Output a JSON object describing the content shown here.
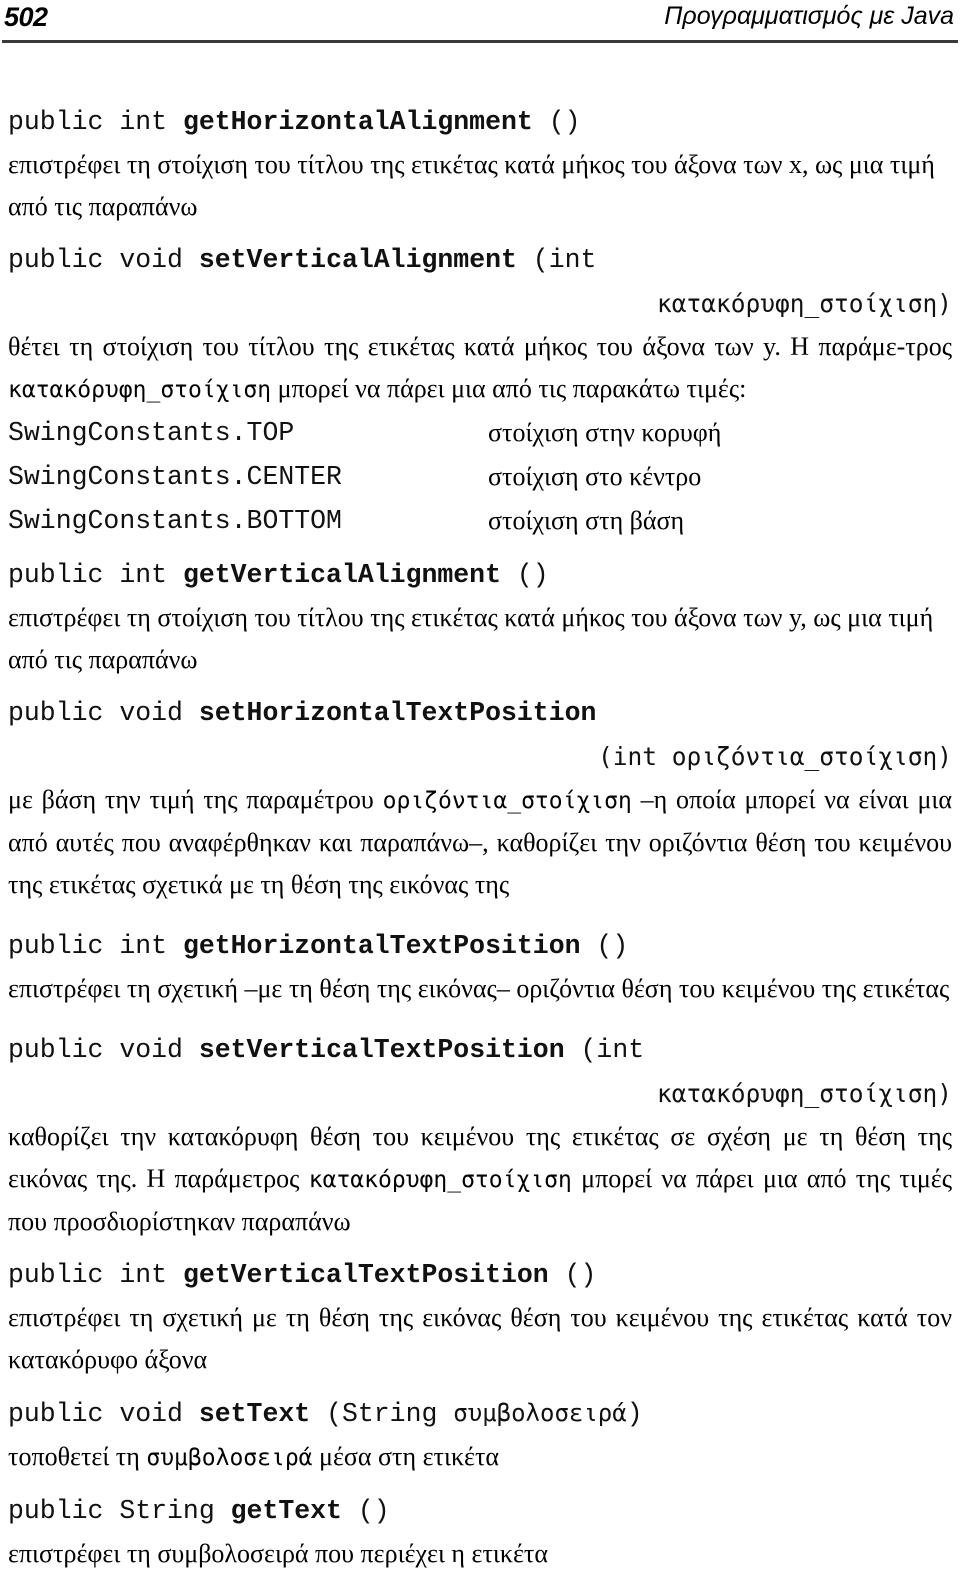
{
  "header": {
    "folio": "502",
    "running_title": "Προγραμματισμός με Java"
  },
  "entries": {
    "e1": {
      "sig_pre": "public int ",
      "sig_name": "getHorizontalAlignment",
      "sig_post": " ()",
      "desc": "επιστρέφει τη στοίχιση του τίτλου της ετικέτας κατά μήκος του άξονα των x, ως μια τιμή από τις παραπάνω"
    },
    "e2": {
      "sig_pre": "public void ",
      "sig_name": "setVerticalAlignment",
      "sig_post": " (int",
      "sig_cont": "κατακόρυφη_στοίχιση)",
      "desc": "θέτει τη στοίχιση του τίτλου της ετικέτας κατά μήκος του άξονα των y. Η παράμετρος κατακόρυφη_στοίχιση μπορεί να πάρει μια από τις παρακάτω τιμές:",
      "desc_part1": "θέτει τη στοίχιση του τίτλου της ετικέτας κατά μήκος του άξονα των y. Η παράμε-",
      "desc_part2_pre": "τρος ",
      "desc_part2_code": "κατακόρυφη_στοίχιση",
      "desc_part2_post": " μπορεί να πάρει μια από τις παρακάτω τιμές:"
    },
    "constants": [
      {
        "name": "SwingConstants.TOP",
        "meaning": "στοίχιση στην κορυφή"
      },
      {
        "name": "SwingConstants.CENTER",
        "meaning": "στοίχιση στο κέντρο"
      },
      {
        "name": "SwingConstants.BOTTOM",
        "meaning": "στοίχιση στη βάση"
      }
    ],
    "e3": {
      "sig_pre": "public int ",
      "sig_name": "getVerticalAlignment",
      "sig_post": " ()",
      "desc": "επιστρέφει τη στοίχιση του τίτλου της ετικέτας κατά μήκος του άξονα των y, ως μια τιμή από τις παραπάνω"
    },
    "e4": {
      "sig_pre": "public void ",
      "sig_name": "setHorizontalTextPosition",
      "sig_post": "",
      "sig_cont": "(int οριζόντια_στοίχιση)",
      "desc_pre": "με βάση την τιμή της παραμέτρου ",
      "desc_code": "οριζόντια_στοίχιση",
      "desc_post": " –η οποία μπορεί να είναι μια από αυτές που αναφέρθηκαν και παραπάνω–, καθορίζει την οριζόντια θέση του κειμένου της ετικέτας σχετικά με τη θέση της εικόνας της"
    },
    "e5": {
      "sig_pre": "public int ",
      "sig_name": "getHorizontalTextPosition",
      "sig_post": " ()",
      "desc": "επιστρέφει τη σχετική –με τη θέση της εικόνας– οριζόντια θέση του κειμένου της ετικέτας"
    },
    "e6": {
      "sig_pre": "public void ",
      "sig_name": "setVerticalTextPosition",
      "sig_post": " (int",
      "sig_cont": "κατακόρυφη_στοίχιση)",
      "desc_pre": "καθορίζει την κατακόρυφη θέση του κειμένου της ετικέτας σε σχέση με τη θέση της εικόνας της. Η παράμετρος ",
      "desc_code": "κατακόρυφη_στοίχιση",
      "desc_post": " μπορεί να πάρει μια από της τιμές που προσδιορίστηκαν παραπάνω"
    },
    "e7": {
      "sig_pre": "public int ",
      "sig_name": "getVerticalTextPosition",
      "sig_post": " ()",
      "desc": "επιστρέφει τη σχετική με τη θέση της εικόνας θέση του κειμένου της ετικέτας κατά τον κατακόρυφο άξονα"
    },
    "e8": {
      "sig_pre": "public void ",
      "sig_name": "setText",
      "sig_post": " (String ",
      "sig_param": "συμβολοσειρά",
      "sig_close": ")",
      "desc_pre": "τοποθετεί τη ",
      "desc_code": "συμβολοσειρά",
      "desc_post": " μέσα στη ετικέτα"
    },
    "e9": {
      "sig_pre": "public String ",
      "sig_name": "getText",
      "sig_post": " ()",
      "desc": "επιστρέφει τη συμβολοσειρά που περιέχει η ετικέτα"
    }
  }
}
